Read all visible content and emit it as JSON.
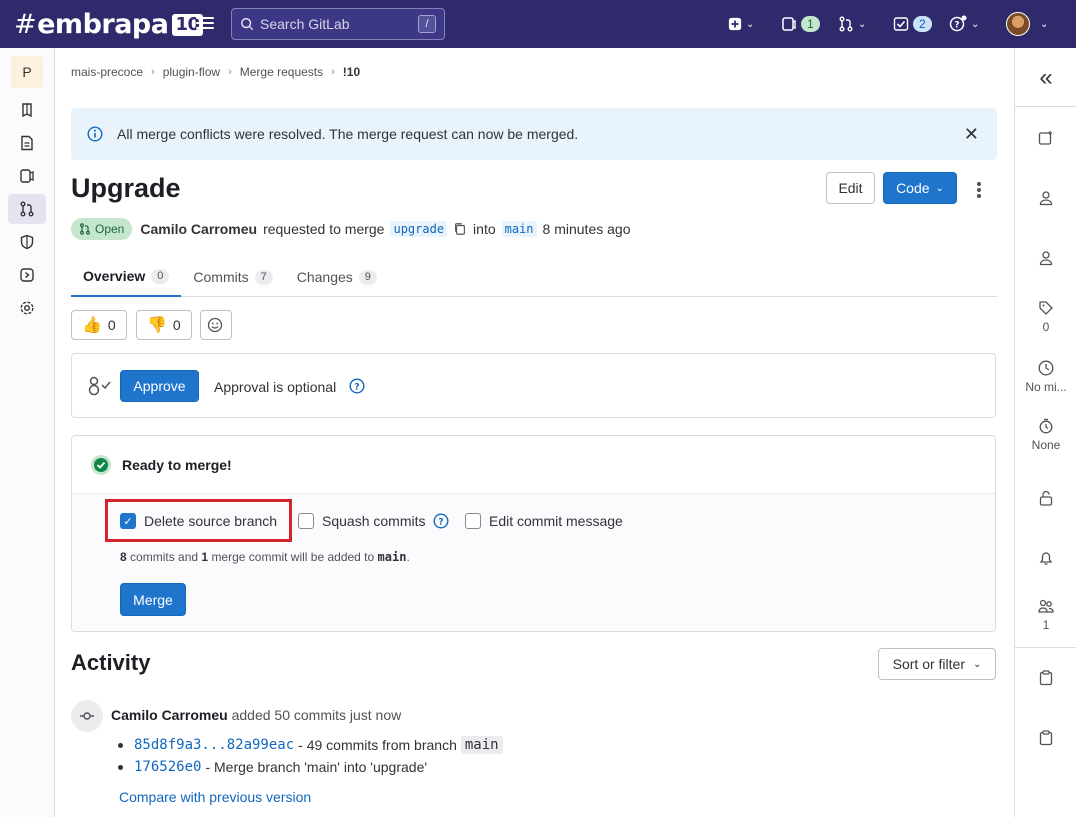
{
  "topbar": {
    "logo_text": "embrapa",
    "logo_badge": "10",
    "search_placeholder": "Search GitLab",
    "search_shortcut": "/",
    "issues_count": "1",
    "todos_count": "2"
  },
  "sidebar": {
    "project_initial": "P"
  },
  "breadcrumb": {
    "items": [
      "mais-precoce",
      "plugin-flow",
      "Merge requests",
      "!10"
    ]
  },
  "alert": {
    "message": "All merge conflicts were resolved. The merge request can now be merged."
  },
  "mr": {
    "title": "Upgrade",
    "edit_label": "Edit",
    "code_label": "Code",
    "status": "Open",
    "author": "Camilo Carromeu",
    "requested_text": "requested to merge",
    "source_branch": "upgrade",
    "into_text": "into",
    "target_branch": "main",
    "time": "8 minutes ago"
  },
  "tabs": [
    {
      "label": "Overview",
      "count": "0"
    },
    {
      "label": "Commits",
      "count": "7"
    },
    {
      "label": "Changes",
      "count": "9"
    }
  ],
  "reactions": {
    "thumbs_up": "0",
    "thumbs_down": "0"
  },
  "approval": {
    "button_label": "Approve",
    "text": "Approval is optional"
  },
  "merge": {
    "status": "Ready to merge!",
    "delete_source_label": "Delete source branch",
    "squash_label": "Squash commits",
    "edit_message_label": "Edit commit message",
    "summary_commits": "8",
    "summary_text_1": "commits and",
    "summary_merge": "1",
    "summary_text_2": "merge commit will be added to",
    "summary_branch": "main",
    "button_label": "Merge"
  },
  "activity": {
    "heading": "Activity",
    "sort_label": "Sort or filter",
    "event_author": "Camilo Carromeu",
    "event_text": "added 50 commits just now",
    "commits": [
      {
        "sha": "85d8f9a3...82a99eac",
        "text": "- 49 commits from branch",
        "branch": "main"
      },
      {
        "sha": "176526e0",
        "text": "- Merge branch 'main' into 'upgrade'"
      }
    ],
    "compare_link": "Compare with previous version"
  },
  "right_sidebar": {
    "labels_count": "0",
    "milestone": "No mi...",
    "time_tracking": "None",
    "participants_count": "1"
  }
}
